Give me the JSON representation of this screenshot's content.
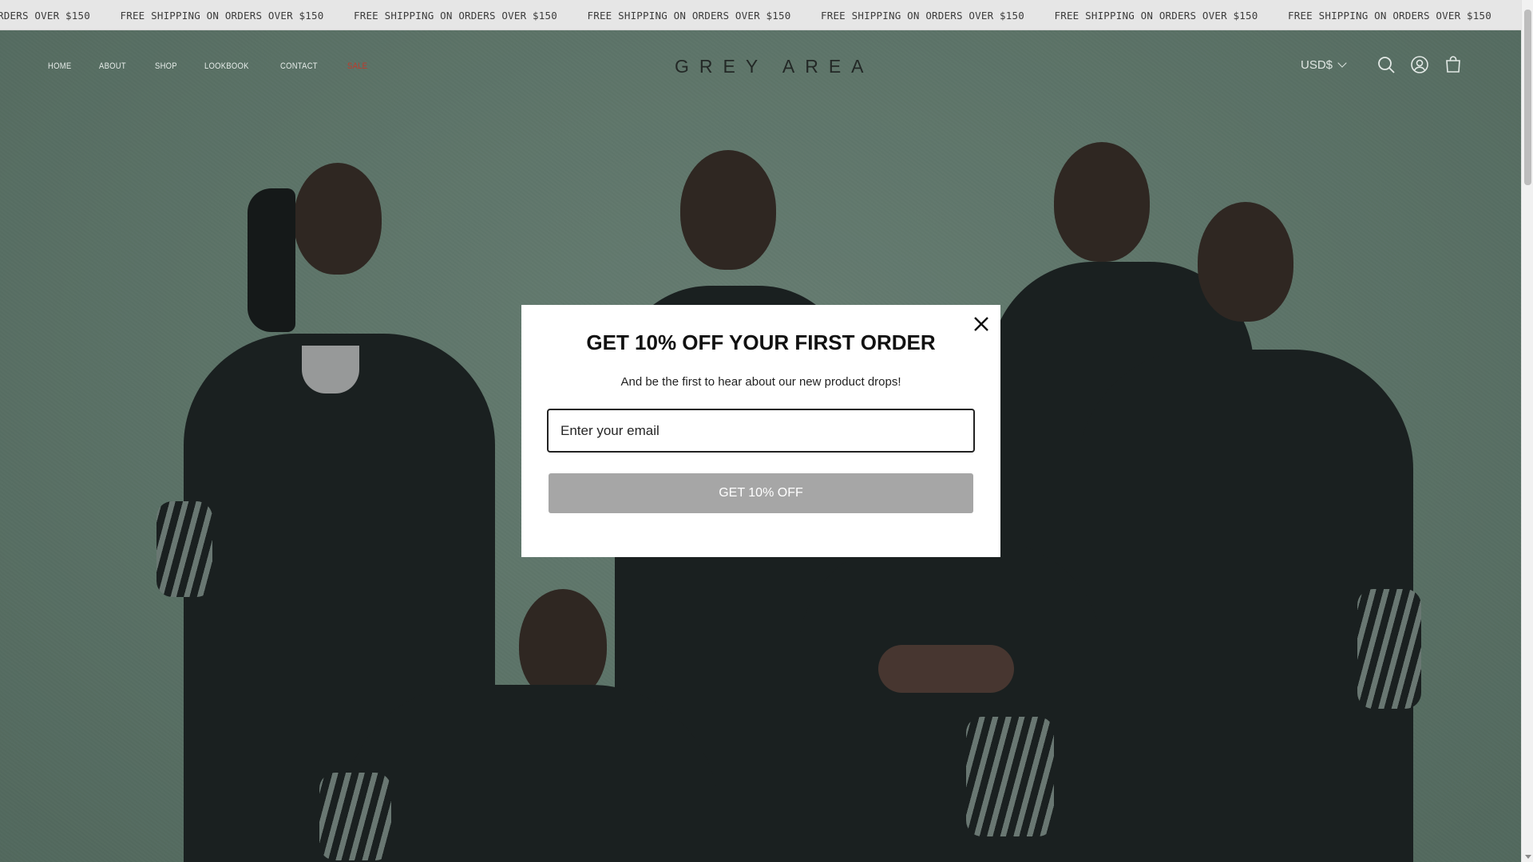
{
  "announcement": {
    "items": [
      "FREE SHIPPING ON ORDERS OVER $150",
      "FREE SHIPPING ON ORDERS OVER $150",
      "FREE SHIPPING ON ORDERS OVER $150",
      "FREE SHIPPING ON ORDERS OVER $150",
      "FREE SHIPPING ON ORDERS OVER $150",
      "FREE SHIPPING ON ORDERS OVER $150",
      "FREE SHIPPING ON ORDERS OVER $150"
    ]
  },
  "header": {
    "nav": [
      {
        "label": "HOME"
      },
      {
        "label": "ABOUT"
      },
      {
        "label": "SHOP"
      },
      {
        "label": "LOOKBOOK"
      },
      {
        "label": "CONTACT"
      },
      {
        "label": "SALE"
      }
    ],
    "logo": "GREY AREA",
    "currency": "USD$",
    "icons": [
      "search-icon",
      "account-icon",
      "cart-icon"
    ]
  },
  "modal": {
    "title": "GET 10% OFF YOUR FIRST ORDER",
    "subtitle": "And be the first to hear about our new product drops!",
    "email_placeholder": "Enter your email",
    "email_value": "",
    "submit_label": "GET 10% OFF",
    "close_icon": "close-icon"
  },
  "colors": {
    "sale": "#c0392b",
    "hero_bg": "#7a9787",
    "button_disabled": "#a6a6a6"
  }
}
